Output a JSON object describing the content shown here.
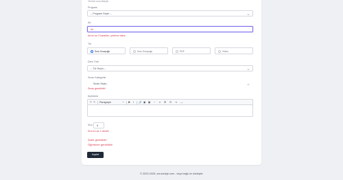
{
  "top_note": "Yeni bir soru ekleyin",
  "form": {
    "program": {
      "label": "Program",
      "value": "-- Program Seçin --"
    },
    "ad": {
      "label": "Ad",
      "value": "üü",
      "error": "Ad en az 3 karakter, çevirme daha"
    },
    "tur": {
      "label": "Tür",
      "options": [
        {
          "label": "Soru Kısaçuğu",
          "selected": true
        },
        {
          "label": "Soru Kısaçuğu",
          "selected": false
        },
        {
          "label": "PDF",
          "selected": false
        },
        {
          "label": "Video",
          "selected": false
        }
      ]
    },
    "ders_turu": {
      "label": "Ders Türü",
      "value": "-- Tür Seçin --"
    },
    "sinav_kategorisi": {
      "label": "Sınav Kategorisi",
      "value": "Sınav Seçin...",
      "error": "Sınav gereklidir!"
    },
    "aciklama": {
      "label": "Açıklama",
      "toolbar": {
        "undo": "↶",
        "redo": "↷",
        "font": "Paragraph",
        "bold": "B",
        "italic": "I",
        "link": "🔗",
        "image": "▣",
        "table": "▦",
        "more": "⋯",
        "align": "≡",
        "list1": "☰",
        "list2": "☷",
        "indent": "⇥",
        "hr": "—"
      }
    },
    "sira": {
      "label": "Sıra",
      "value": "0",
      "error": "Sıra en az 1 olmalı!"
    },
    "errors_bottom": [
      "Şube gereklidir!",
      "Öğretmen gereklidir!"
    ],
    "submit": "Kaydet"
  },
  "footer": "© 2023-2025, sorucetoje.com - veya bağlı ve sözleşler",
  "colors": {
    "error": "#d9364d",
    "focus": "#7c6df0",
    "button": "#1f2937",
    "radio": "#2563eb"
  }
}
